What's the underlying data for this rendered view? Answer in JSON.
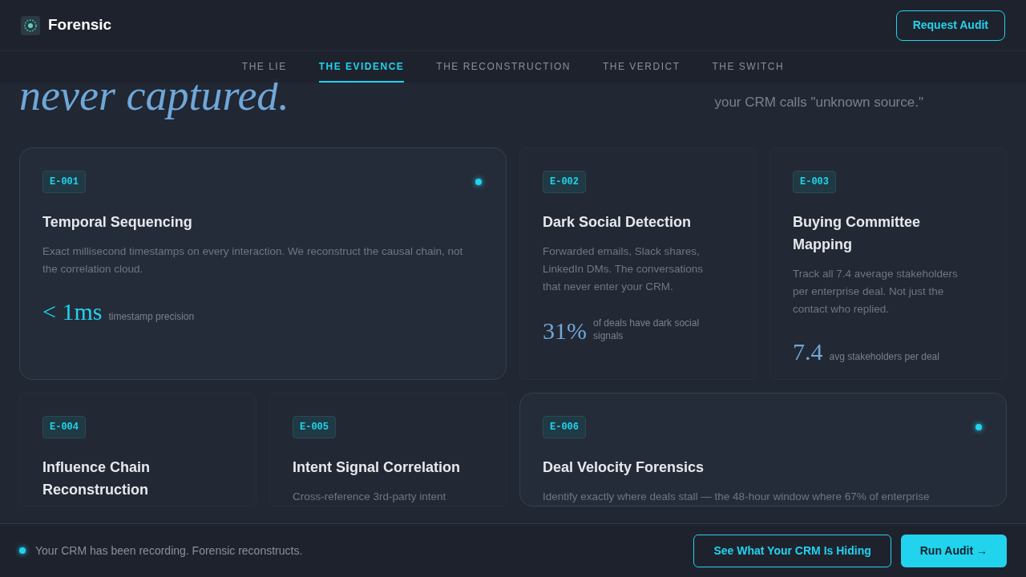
{
  "header": {
    "brand": "Forensic",
    "cta": "Request Audit"
  },
  "nav": [
    {
      "label": "THE LIE",
      "selected": false
    },
    {
      "label": "THE EVIDENCE",
      "selected": true
    },
    {
      "label": "THE RECONSTRUCTION",
      "selected": false
    },
    {
      "label": "THE VERDICT",
      "selected": false
    },
    {
      "label": "THE SWITCH",
      "selected": false
    }
  ],
  "hero": {
    "headline": "never captured.",
    "subtext": "your CRM calls \"unknown source.\""
  },
  "cards": [
    {
      "code": "E-001",
      "featured": true,
      "title": "Temporal Sequencing",
      "description": "Exact millisecond timestamps on every interaction. We reconstruct the causal chain, not the correlation cloud.",
      "metric": "< 1ms",
      "metric_label": "timestamp precision"
    },
    {
      "code": "E-002",
      "featured": false,
      "title": "Dark Social Detection",
      "description": "Forwarded emails, Slack shares, LinkedIn DMs. The conversations that never enter your CRM.",
      "metric": "31%",
      "metric_label": "of deals have dark social signals"
    },
    {
      "code": "E-003",
      "featured": false,
      "title": "Buying Committee Mapping",
      "description": "Track all 7.4 average stakeholders per enterprise deal. Not just the contact who replied.",
      "metric": "7.4",
      "metric_label": "avg stakeholders per deal"
    },
    {
      "code": "E-004",
      "featured": false,
      "title": "Influence Chain Reconstruction"
    },
    {
      "code": "E-005",
      "featured": false,
      "title": "Intent Signal Correlation",
      "description": "Cross-reference 3rd-party intent"
    },
    {
      "code": "E-006",
      "featured": true,
      "title": "Deal Velocity Forensics",
      "description": "Identify exactly where deals stall — the 48-hour window where 67% of enterprise"
    }
  ],
  "bottom_bar": {
    "message": "Your CRM has been recording. Forensic reconstructs.",
    "secondary_button": "See What Your CRM Is Hiding",
    "primary_button": "Run Audit →"
  }
}
